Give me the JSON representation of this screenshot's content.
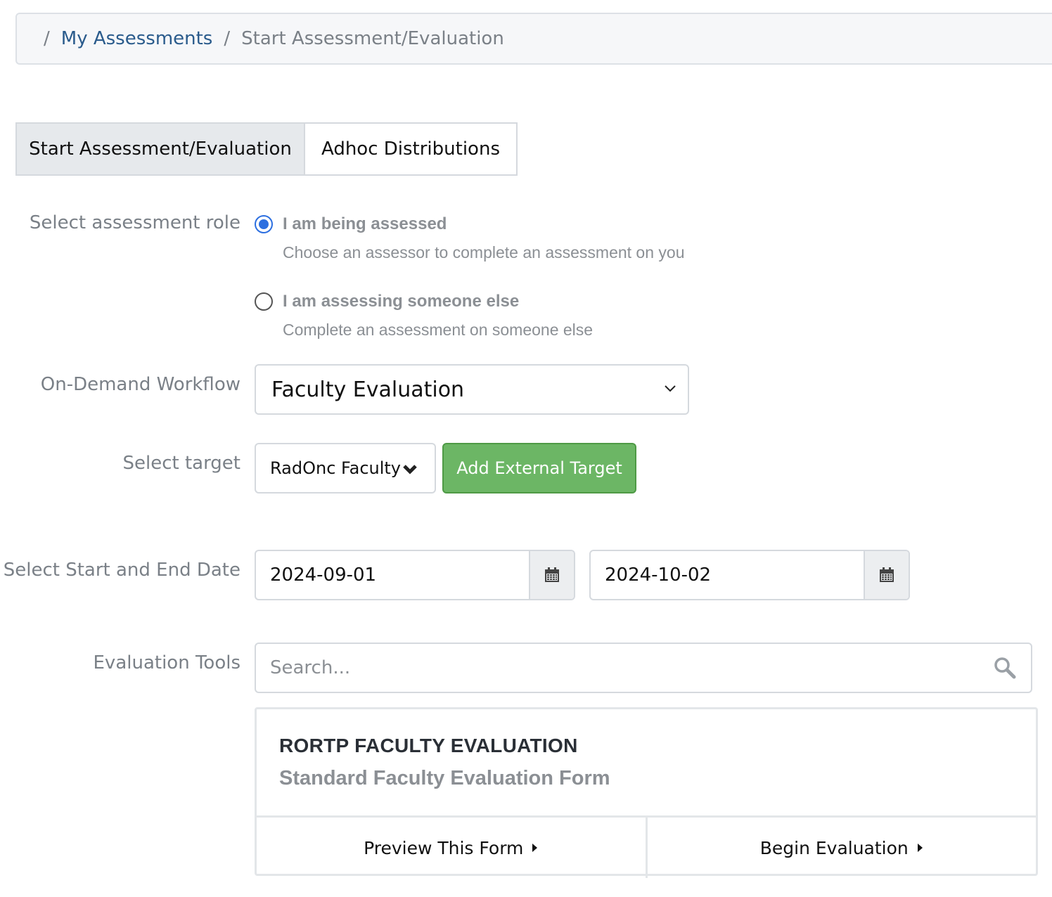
{
  "breadcrumb": {
    "separator": "/",
    "link": "My Assessments",
    "current": "Start Assessment/Evaluation"
  },
  "tabs": [
    {
      "label": "Start Assessment/Evaluation",
      "active": true
    },
    {
      "label": "Adhoc Distributions",
      "active": false
    }
  ],
  "role": {
    "label": "Select assessment role",
    "options": [
      {
        "title": "I am being assessed",
        "description": "Choose an assessor to complete an assessment on you",
        "checked": true
      },
      {
        "title": "I am assessing someone else",
        "description": "Complete an assessment on someone else",
        "checked": false
      }
    ]
  },
  "workflow": {
    "label": "On-Demand Workflow",
    "selected": "Faculty Evaluation",
    "icon": "chevron-down-icon"
  },
  "target": {
    "label": "Select target",
    "selected": "RadOnc Faculty",
    "add_button": "Add External Target",
    "add_button_color": "#6cb665"
  },
  "dates": {
    "label": "Select Start and End Date",
    "start": "2024-09-01",
    "end": "2024-10-02",
    "icon": "calendar-icon"
  },
  "tools": {
    "label": "Evaluation Tools",
    "search_placeholder": "Search...",
    "search_icon": "search-icon",
    "card": {
      "title": "RORTP FACULTY EVALUATION",
      "subtitle": "Standard Faculty Evaluation Form",
      "preview_label": "Preview This Form",
      "begin_label": "Begin Evaluation"
    }
  },
  "colors": {
    "link": "#2a5b8c",
    "radio_accent": "#2c6fe0",
    "muted_text": "#7a8087"
  }
}
